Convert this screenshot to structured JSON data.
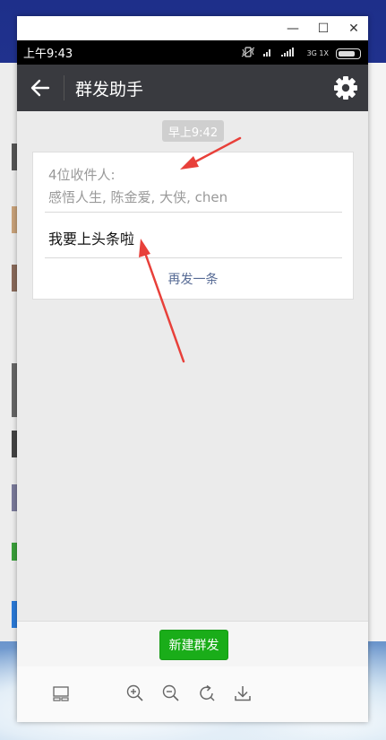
{
  "window": {
    "minimize_glyph": "—",
    "maximize_glyph": "☐",
    "close_glyph": "✕"
  },
  "status_bar": {
    "time": "上午9:43",
    "network_label": "3G 1X",
    "icons": [
      "vibrate-icon",
      "signal-icon",
      "signal-icon",
      "battery-icon"
    ]
  },
  "app_bar": {
    "title": "群发助手",
    "back_icon": "arrow-left-icon",
    "settings_icon": "gear-icon"
  },
  "chat": {
    "timestamp": "早上9:42",
    "card": {
      "recipient_count_label": "4位收件人:",
      "recipients": "感悟人生, 陈金爱, 大侠, chen",
      "message": "我要上头条啦",
      "resend_label": "再发一条"
    }
  },
  "footer": {
    "new_broadcast_label": "新建群发"
  },
  "toolbar": {
    "icons": [
      "layout-icon",
      "zoom-in-icon",
      "zoom-out-icon",
      "rotate-icon",
      "download-icon"
    ]
  },
  "colors": {
    "app_bar": "#393a3f",
    "primary_button": "#1aad19",
    "link": "#576b95",
    "annotation_arrow": "#e8403a"
  }
}
